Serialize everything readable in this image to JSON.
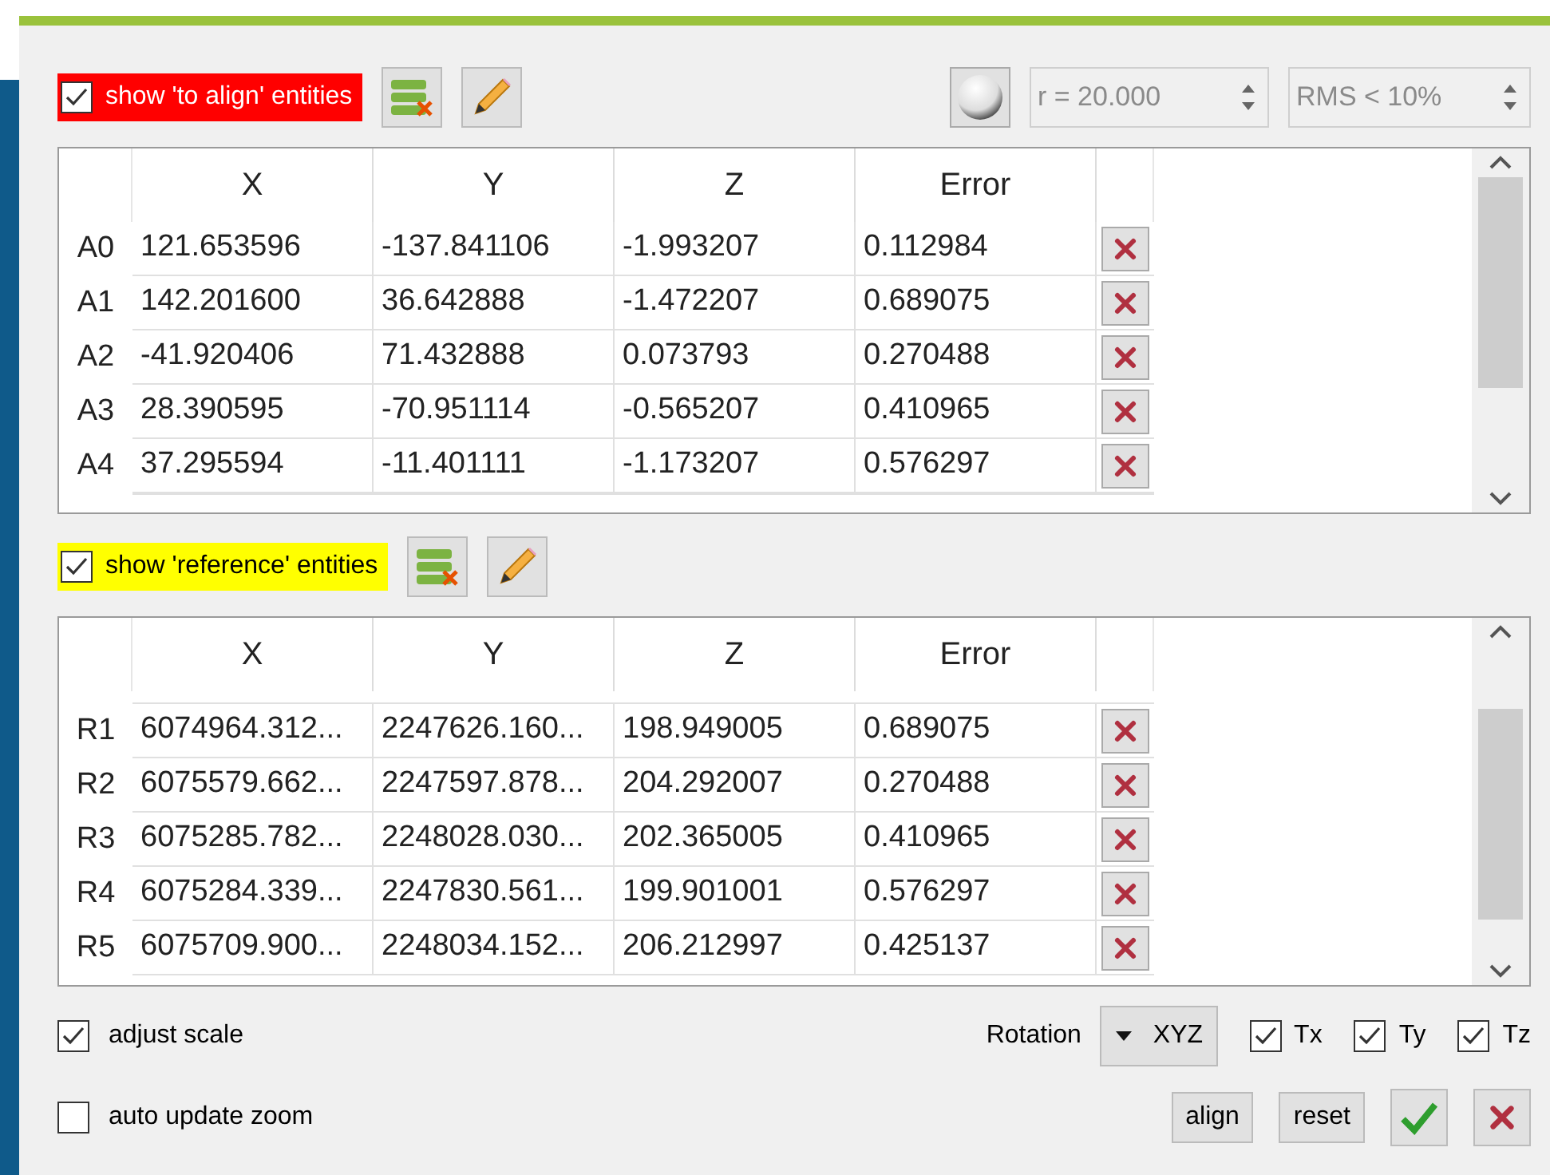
{
  "sections": [
    {
      "label": "show 'to align' entities",
      "checked": true,
      "color": "#ff0000",
      "columns": [
        "X",
        "Y",
        "Z",
        "Error"
      ],
      "scroll_offset": false,
      "rows": [
        {
          "name": "A0",
          "cells": [
            "121.653596",
            "-137.841106",
            "-1.993207",
            "0.112984"
          ]
        },
        {
          "name": "A1",
          "cells": [
            "142.201600",
            "36.642888",
            "-1.472207",
            "0.689075"
          ]
        },
        {
          "name": "A2",
          "cells": [
            "-41.920406",
            "71.432888",
            "0.073793",
            "0.270488"
          ]
        },
        {
          "name": "A3",
          "cells": [
            "28.390595",
            "-70.951114",
            "-0.565207",
            "0.410965"
          ]
        },
        {
          "name": "A4",
          "cells": [
            "37.295594",
            "-11.401111",
            "-1.173207",
            "0.576297"
          ]
        }
      ]
    },
    {
      "label": "show 'reference' entities",
      "checked": true,
      "color": "#ffff00",
      "columns": [
        "X",
        "Y",
        "Z",
        "Error"
      ],
      "scroll_offset": true,
      "rows": [
        {
          "name": "R1",
          "cells": [
            "6074964.312...",
            "2247626.160...",
            "198.949005",
            "0.689075"
          ]
        },
        {
          "name": "R2",
          "cells": [
            "6075579.662...",
            "2247597.878...",
            "204.292007",
            "0.270488"
          ]
        },
        {
          "name": "R3",
          "cells": [
            "6075285.782...",
            "2248028.030...",
            "202.365005",
            "0.410965"
          ]
        },
        {
          "name": "R4",
          "cells": [
            "6075284.339...",
            "2247830.561...",
            "199.901001",
            "0.576297"
          ]
        },
        {
          "name": "R5",
          "cells": [
            "6075709.900...",
            "2248034.152...",
            "206.212997",
            "0.425137"
          ]
        }
      ]
    }
  ],
  "radius_field": {
    "value": "r = 20.000",
    "disabled": true
  },
  "rms_field": {
    "value": "RMS < 10%",
    "disabled": true
  },
  "adjust_scale": {
    "label": "adjust scale",
    "checked": true
  },
  "auto_update_zoom": {
    "label": "auto update zoom",
    "checked": false
  },
  "rotation": {
    "label": "Rotation",
    "value": "XYZ"
  },
  "translations": [
    {
      "label": "Tx",
      "checked": true
    },
    {
      "label": "Ty",
      "checked": true
    },
    {
      "label": "Tz",
      "checked": true
    }
  ],
  "buttons": [
    {
      "label": "align"
    },
    {
      "label": "reset"
    }
  ]
}
